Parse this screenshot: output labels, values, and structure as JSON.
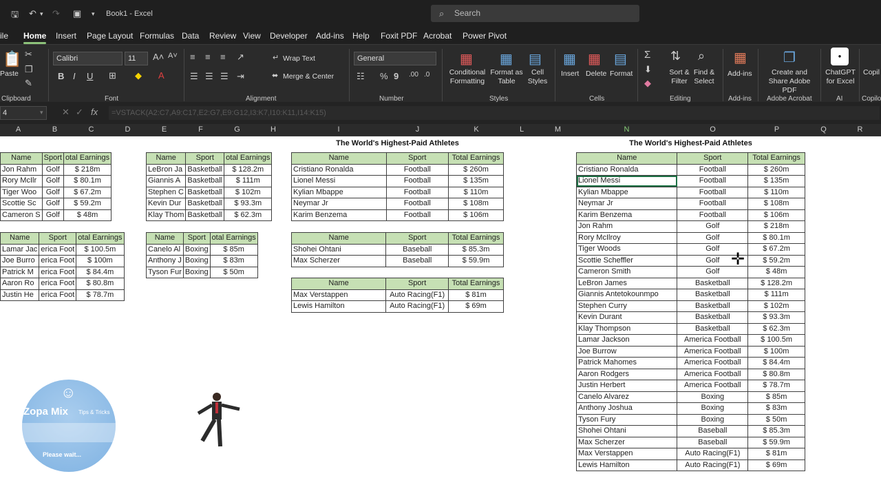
{
  "app": {
    "workbook": "Book1 - Excel",
    "search_placeholder": "Search"
  },
  "tabs": [
    "ile",
    "Home",
    "Insert",
    "Page Layout",
    "Formulas",
    "Data",
    "Review",
    "View",
    "Developer",
    "Add-ins",
    "Help",
    "Foxit PDF",
    "Acrobat",
    "Power Pivot"
  ],
  "ribbon": {
    "paste": "Paste",
    "font_name": "Calibri",
    "font_size": "11",
    "number_format": "General",
    "wrap_text": "Wrap Text",
    "merge_center": "Merge & Center",
    "cond_fmt": "Conditional Formatting",
    "format_table": "Format as Table",
    "cell_styles": "Cell Styles",
    "insert": "Insert",
    "delete": "Delete",
    "format": "Format",
    "sort_filter": "Sort & Filter",
    "find_select": "Find & Select",
    "addins": "Add-ins",
    "create_share": "Create and Share Adobe PDF",
    "chatgpt": "ChatGPT for Excel",
    "copilot": "Copil",
    "groups": {
      "clipboard": "Clipboard",
      "font": "Font",
      "alignment": "Alignment",
      "number": "Number",
      "styles": "Styles",
      "cells": "Cells",
      "editing": "Editing",
      "addins": "Add-ins",
      "adobe": "Adobe Acrobat",
      "ai": "AI",
      "copilot": "Copilo"
    }
  },
  "formula_bar": {
    "name_box": "4",
    "formula": "=VSTACK(A2:C7,A9:C17,E2:G7,E9:G12,I3:K7,I10:K11,I14:K15)"
  },
  "columns": [
    "A",
    "B",
    "C",
    "D",
    "E",
    "F",
    "G",
    "H",
    "I",
    "J",
    "K",
    "L",
    "M",
    "N",
    "O",
    "P",
    "Q",
    "R"
  ],
  "headers": {
    "name": "Name",
    "sport": "Sport",
    "earnings": "Total Earnings",
    "earnings_cut": "otal Earnings"
  },
  "title": "The World's Highest-Paid Athletes",
  "golf": [
    [
      "Jon Rahm",
      "Golf",
      "$ 218m"
    ],
    [
      "Rory McIlr",
      "Golf",
      "$ 80.1m"
    ],
    [
      "Tiger Woo",
      "Golf",
      "$ 67.2m"
    ],
    [
      "Scottie Sc",
      "Golf",
      "$ 59.2m"
    ],
    [
      "Cameron S",
      "Golf",
      "$ 48m"
    ]
  ],
  "amfoot": [
    [
      "Lamar Jac",
      "erica Foot",
      "$ 100.5m"
    ],
    [
      "Joe Burro",
      "erica Foot",
      "$ 100m"
    ],
    [
      "Patrick M",
      "erica Foot",
      "$ 84.4m"
    ],
    [
      "Aaron Ro",
      "erica Foot",
      "$ 80.8m"
    ],
    [
      "Justin He",
      "erica Foot",
      "$ 78.7m"
    ]
  ],
  "basket": [
    [
      "LeBron Ja",
      "Basketball",
      "$ 128.2m"
    ],
    [
      "Giannis A",
      "Basketball",
      "$ 111m"
    ],
    [
      "Stephen C",
      "Basketball",
      "$ 102m"
    ],
    [
      "Kevin Dur",
      "Basketball",
      "$ 93.3m"
    ],
    [
      "Klay Thom",
      "Basketball",
      "$ 62.3m"
    ]
  ],
  "boxing": [
    [
      "Canelo Al",
      "Boxing",
      "$ 85m"
    ],
    [
      "Anthony J",
      "Boxing",
      "$ 83m"
    ],
    [
      "Tyson Fur",
      "Boxing",
      "$ 50m"
    ]
  ],
  "football": [
    [
      "Cristiano Ronalda",
      "Football",
      "$ 260m"
    ],
    [
      "Lionel Messi",
      "Football",
      "$ 135m"
    ],
    [
      "Kylian Mbappe",
      "Football",
      "$ 110m"
    ],
    [
      "Neymar Jr",
      "Football",
      "$ 108m"
    ],
    [
      "Karim Benzema",
      "Football",
      "$ 106m"
    ]
  ],
  "baseball": [
    [
      "Shohei Ohtani",
      "Baseball",
      "$ 85.3m"
    ],
    [
      "Max Scherzer",
      "Baseball",
      "$ 59.9m"
    ]
  ],
  "f1": [
    [
      "Max Verstappen",
      "Auto Racing(F1)",
      "$ 81m"
    ],
    [
      "Lewis Hamilton",
      "Auto Racing(F1)",
      "$ 69m"
    ]
  ],
  "combined": [
    [
      "Cristiano Ronalda",
      "Football",
      "$ 260m"
    ],
    [
      "Lionel Messi",
      "Football",
      "$ 135m"
    ],
    [
      "Kylian Mbappe",
      "Football",
      "$ 110m"
    ],
    [
      "Neymar Jr",
      "Football",
      "$ 108m"
    ],
    [
      "Karim Benzema",
      "Football",
      "$ 106m"
    ],
    [
      "Jon Rahm",
      "Golf",
      "$ 218m"
    ],
    [
      "Rory McIlroy",
      "Golf",
      "$ 80.1m"
    ],
    [
      "Tiger Woods",
      "Golf",
      "$ 67.2m"
    ],
    [
      "Scottie Scheffler",
      "Golf",
      "$ 59.2m"
    ],
    [
      "Cameron Smith",
      "Golf",
      "$ 48m"
    ],
    [
      "LeBron James",
      "Basketball",
      "$ 128.2m"
    ],
    [
      "Giannis Antetokounmpo",
      "Basketball",
      "$ 111m"
    ],
    [
      "Stephen Curry",
      "Basketball",
      "$ 102m"
    ],
    [
      "Kevin Durant",
      "Basketball",
      "$ 93.3m"
    ],
    [
      "Klay Thompson",
      "Basketball",
      "$ 62.3m"
    ],
    [
      "Lamar Jackson",
      "America Football",
      "$ 100.5m"
    ],
    [
      "Joe Burrow",
      "America Football",
      "$ 100m"
    ],
    [
      "Patrick Mahomes",
      "America Football",
      "$ 84.4m"
    ],
    [
      "Aaron Rodgers",
      "America Football",
      "$ 80.8m"
    ],
    [
      "Justin Herbert",
      "America Football",
      "$ 78.7m"
    ],
    [
      "Canelo Alvarez",
      "Boxing",
      "$ 85m"
    ],
    [
      "Anthony Joshua",
      "Boxing",
      "$ 83m"
    ],
    [
      "Tyson Fury",
      "Boxing",
      "$ 50m"
    ],
    [
      "Shohei Ohtani",
      "Baseball",
      "$ 85.3m"
    ],
    [
      "Max Scherzer",
      "Baseball",
      "$ 59.9m"
    ],
    [
      "Max Verstappen",
      "Auto Racing(F1)",
      "$ 81m"
    ],
    [
      "Lewis Hamilton",
      "Auto Racing(F1)",
      "$ 69m"
    ]
  ],
  "overlay": {
    "brand": "Zopa Mix",
    "tagline": "Tips & Tricks",
    "wait": "Please wait..."
  }
}
